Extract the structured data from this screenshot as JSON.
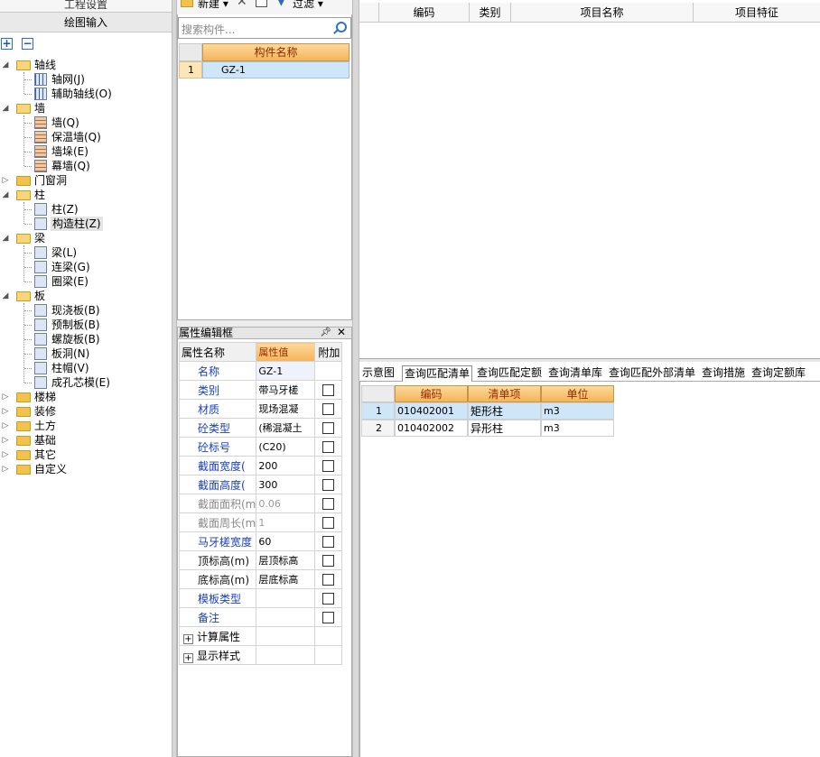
{
  "left": {
    "top_strip_label": "工程设置",
    "draw_input_label": "绘图输入",
    "add_label": "+",
    "remove_label": "−",
    "tree": [
      {
        "label": "轴线",
        "expanded": true,
        "children": [
          "轴网(J)",
          "辅助轴线(O)"
        ]
      },
      {
        "label": "墙",
        "expanded": true,
        "children": [
          "墙(Q)",
          "保温墙(Q)",
          "墙垛(E)",
          "幕墙(Q)"
        ]
      },
      {
        "label": "门窗洞",
        "expanded": false,
        "children": []
      },
      {
        "label": "柱",
        "expanded": true,
        "children": [
          "柱(Z)",
          "构造柱(Z)"
        ]
      },
      {
        "label": "梁",
        "expanded": true,
        "children": [
          "梁(L)",
          "连梁(G)",
          "圈梁(E)"
        ]
      },
      {
        "label": "板",
        "expanded": true,
        "children": [
          "现浇板(B)",
          "预制板(B)",
          "螺旋板(B)",
          "板洞(N)",
          "柱帽(V)",
          "成孔芯模(E)"
        ]
      },
      {
        "label": "楼梯",
        "expanded": false,
        "children": []
      },
      {
        "label": "装修",
        "expanded": false,
        "children": []
      },
      {
        "label": "土方",
        "expanded": false,
        "children": []
      },
      {
        "label": "基础",
        "expanded": false,
        "children": []
      },
      {
        "label": "其它",
        "expanded": false,
        "children": []
      },
      {
        "label": "自定义",
        "expanded": false,
        "children": []
      }
    ],
    "selected": "构造柱(Z)"
  },
  "component": {
    "new_label": "新建",
    "filter_label": "过滤",
    "search_placeholder": "搜索构件...",
    "column_header": "构件名称",
    "rows": [
      {
        "index": "1",
        "name": "GZ-1"
      }
    ]
  },
  "properties": {
    "title": "属性编辑框",
    "pin_glyph": "𝟰",
    "close_glyph": "✕",
    "headers": [
      "属性名称",
      "属性值",
      "附加"
    ],
    "rows": [
      {
        "name": "名称",
        "value": "GZ-1",
        "style": "blue",
        "check": false
      },
      {
        "name": "类别",
        "value": "带马牙槎",
        "style": "blue",
        "check": true
      },
      {
        "name": "材质",
        "value": "现场混凝",
        "style": "blue",
        "check": true
      },
      {
        "name": "砼类型",
        "value": "(稀混凝土",
        "style": "blue",
        "check": true
      },
      {
        "name": "砼标号",
        "value": "(C20)",
        "style": "blue",
        "check": true
      },
      {
        "name": "截面宽度(",
        "value": "200",
        "style": "blue",
        "check": true
      },
      {
        "name": "截面高度(",
        "value": "300",
        "style": "blue",
        "check": true
      },
      {
        "name": "截面面积(m",
        "value": "0.06",
        "style": "gray",
        "check": true
      },
      {
        "name": "截面周长(m",
        "value": "1",
        "style": "gray",
        "check": true
      },
      {
        "name": "马牙槎宽度",
        "value": "60",
        "style": "blue",
        "check": true
      },
      {
        "name": "顶标高(m)",
        "value": "层顶标高",
        "style": "blk",
        "check": true
      },
      {
        "name": "底标高(m)",
        "value": "层底标高",
        "style": "blk",
        "check": true
      },
      {
        "name": "模板类型",
        "value": "",
        "style": "blue",
        "check": true
      },
      {
        "name": "备注",
        "value": "",
        "style": "blue",
        "check": true
      }
    ],
    "groups": [
      "计算属性",
      "显示样式"
    ]
  },
  "right": {
    "top_headers": [
      "编码",
      "类别",
      "项目名称",
      "项目特征"
    ],
    "tabs": [
      "示意图",
      "查询匹配清单",
      "查询匹配定额",
      "查询清单库",
      "查询匹配外部清单",
      "查询措施",
      "查询定额库"
    ],
    "active_tab": "查询匹配清单",
    "bottom_headers": [
      "编码",
      "清单项",
      "单位"
    ],
    "bottom_rows": [
      {
        "index": "1",
        "code": "010402001",
        "item": "矩形柱",
        "unit": "m3"
      },
      {
        "index": "2",
        "code": "010402002",
        "item": "异形柱",
        "unit": "m3"
      }
    ]
  }
}
